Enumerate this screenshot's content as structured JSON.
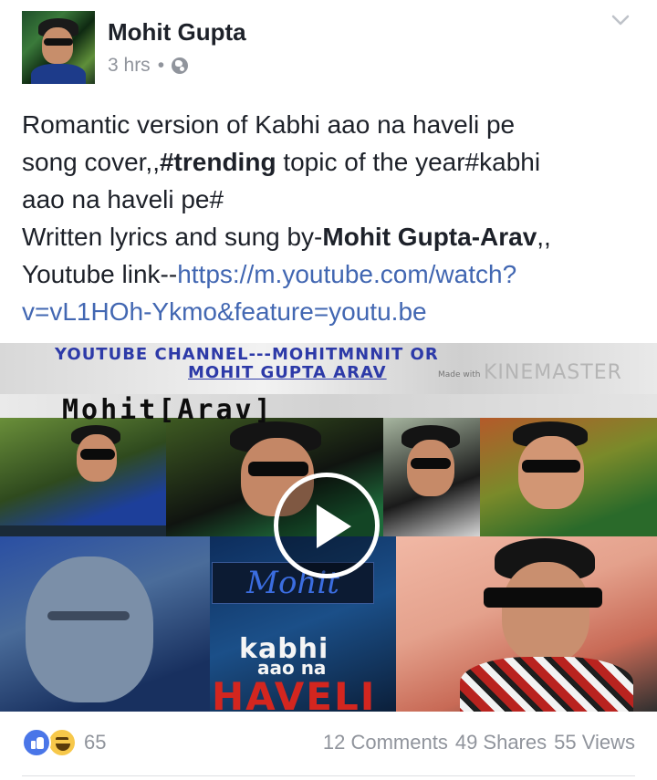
{
  "post": {
    "author": "Mohit Gupta",
    "time": "3 hrs",
    "separator": "•",
    "privacy_icon": "globe-icon",
    "menu_icon": "chevron-down-icon",
    "text": {
      "line1": "Romantic version of Kabhi aao na haveli pe",
      "line2_pre": "song cover,,",
      "line2_bold": "#trending",
      "line2_post": " topic of the year#kabhi",
      "line3": "aao na haveli pe#",
      "line4_pre": "Written lyrics and sung by-",
      "line4_bold": "Mohit Gupta-Arav",
      "line4_post": ",,",
      "line5_pre": "Youtube link--",
      "link_part1": "https://m.youtube.com/watch?",
      "link_part2": "v=vL1HOh-Ykmo&feature=youtu.be"
    }
  },
  "video": {
    "banner_line1": "YOUTUBE CHANNEL---MOHITMNNIT OR",
    "banner_line2": "MOHIT GUPTA ARAV",
    "made_with": "Made with",
    "watermark": "KINEMASTER",
    "arav_title": "Mohit[Arav]",
    "sign_text": "Mohit",
    "kabhi": "kabhi",
    "aao_na": "aao na",
    "haveli": "HAVELI",
    "play_icon": "play-icon"
  },
  "footer": {
    "reaction_icons": [
      "like-icon",
      "haha-icon"
    ],
    "reaction_count": "65",
    "comments": "12 Comments",
    "shares": "49 Shares",
    "views": "55 Views"
  }
}
